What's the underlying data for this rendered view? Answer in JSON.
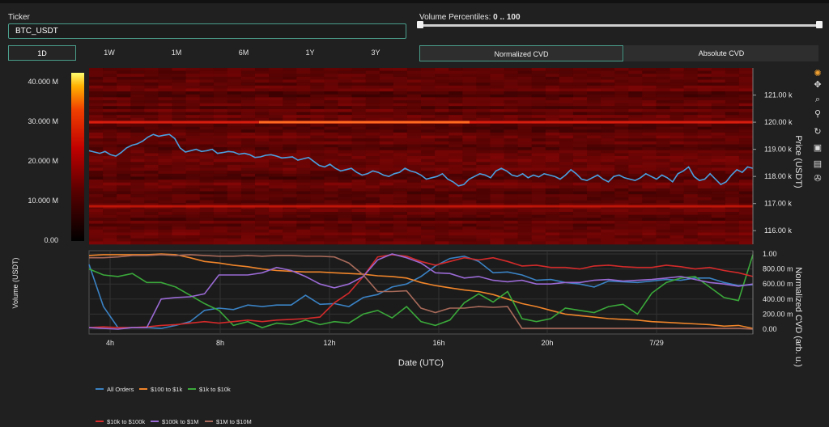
{
  "ticker": {
    "label": "Ticker",
    "value": "BTC_USDT"
  },
  "volume_percentiles": {
    "label": "Volume Percentiles:",
    "value": "0 .. 100",
    "low": 0,
    "high": 100
  },
  "timeframes": [
    {
      "label": "1D",
      "active": true
    },
    {
      "label": "1W",
      "active": false
    },
    {
      "label": "1M",
      "active": false
    },
    {
      "label": "6M",
      "active": false
    },
    {
      "label": "1Y",
      "active": false
    },
    {
      "label": "3Y",
      "active": false
    }
  ],
  "modes": [
    {
      "label": "Normalized CVD",
      "active": true
    },
    {
      "label": "Absolute CVD",
      "active": false
    }
  ],
  "toolbar": {
    "icons": [
      "logo-icon",
      "pan-icon",
      "zoom-icon",
      "lasso-icon",
      "reset-icon",
      "download-icon",
      "comment-icon",
      "settings-icon"
    ]
  },
  "chart_data": [
    {
      "type": "heatmap",
      "title": "",
      "colorbar": {
        "label": "Volume (USDT)",
        "ticks": [
          "40.000 M",
          "30.000 M",
          "20.000 M",
          "10.000 M",
          "0.00"
        ],
        "range": [
          0,
          42000000
        ]
      },
      "ylabel": "Price (USDT)",
      "y_ticks": [
        "121.00 k",
        "120.00 k",
        "119.00 k",
        "118.00 k",
        "117.00 k",
        "116.00 k"
      ],
      "ylim": [
        115500,
        122000
      ],
      "hot_levels": [
        {
          "price": 120000,
          "intensity": 0.75
        },
        {
          "price": 116900,
          "intensity": 0.55
        }
      ],
      "series": [
        {
          "name": "",
          "color": "#4aa0e0",
          "values": [
            118.95,
            118.9,
            118.85,
            118.92,
            118.8,
            118.75,
            118.88,
            119.05,
            119.15,
            119.2,
            119.3,
            119.45,
            119.55,
            119.48,
            119.52,
            119.55,
            119.4,
            119.05,
            118.9,
            118.95,
            119.0,
            118.92,
            118.95,
            119.0,
            118.85,
            118.88,
            118.92,
            118.9,
            118.82,
            118.85,
            118.8,
            118.7,
            118.72,
            118.78,
            118.8,
            118.75,
            118.68,
            118.7,
            118.72,
            118.6,
            118.65,
            118.7,
            118.55,
            118.4,
            118.35,
            118.45,
            118.3,
            118.2,
            118.25,
            118.3,
            118.15,
            118.05,
            118.1,
            118.2,
            118.15,
            118.05,
            118.0,
            118.1,
            118.15,
            118.3,
            118.2,
            118.15,
            118.05,
            117.9,
            117.95,
            118.0,
            118.1,
            117.9,
            117.8,
            117.65,
            117.7,
            117.9,
            118.0,
            118.1,
            118.05,
            117.95,
            118.2,
            118.3,
            118.2,
            118.05,
            118.0,
            118.1,
            117.95,
            118.05,
            117.98,
            118.1,
            118.05,
            118.0,
            117.9,
            118.05,
            118.25,
            118.1,
            117.9,
            117.85,
            117.95,
            118.05,
            117.9,
            117.8,
            118.0,
            118.05,
            117.95,
            117.9,
            117.85,
            117.95,
            118.1,
            118.0,
            117.9,
            118.05,
            117.95,
            117.8,
            118.1,
            118.2,
            118.35,
            118.0,
            117.85,
            117.9,
            118.1,
            117.9,
            117.7,
            117.8,
            118.05,
            118.25,
            118.15,
            118.35,
            118.3
          ]
        }
      ]
    },
    {
      "type": "line",
      "xlabel": "Date (UTC)",
      "ylabel": "Normalized CVD (arb. u.)",
      "x_ticks": [
        "4h",
        "8h",
        "12h",
        "16h",
        "20h",
        "7/29"
      ],
      "y_ticks": [
        "1.00",
        "800.00 m",
        "600.00 m",
        "400.00 m",
        "200.00 m",
        "0.00"
      ],
      "ylim": [
        0,
        1
      ],
      "series": [
        {
          "name": "All Orders",
          "color": "#3a82c4",
          "values": [
            0.86,
            0.3,
            0.02,
            0.02,
            0.02,
            0.01,
            0.05,
            0.1,
            0.25,
            0.28,
            0.26,
            0.32,
            0.3,
            0.32,
            0.32,
            0.45,
            0.33,
            0.34,
            0.3,
            0.42,
            0.46,
            0.56,
            0.6,
            0.7,
            0.84,
            0.94,
            0.97,
            0.9,
            0.75,
            0.76,
            0.72,
            0.65,
            0.66,
            0.62,
            0.6,
            0.56,
            0.64,
            0.63,
            0.62,
            0.64,
            0.66,
            0.65,
            0.68,
            0.68,
            0.62,
            0.58,
            0.59
          ]
        },
        {
          "name": "$100 to $1k",
          "color": "#f0852a",
          "values": [
            0.98,
            0.99,
            0.99,
            0.99,
            0.99,
            1.0,
            0.99,
            0.95,
            0.9,
            0.88,
            0.85,
            0.83,
            0.8,
            0.78,
            0.77,
            0.76,
            0.76,
            0.75,
            0.74,
            0.73,
            0.71,
            0.7,
            0.68,
            0.62,
            0.58,
            0.55,
            0.52,
            0.5,
            0.46,
            0.4,
            0.34,
            0.3,
            0.25,
            0.2,
            0.18,
            0.16,
            0.14,
            0.13,
            0.12,
            0.1,
            0.09,
            0.08,
            0.07,
            0.06,
            0.04,
            0.05,
            0.01
          ]
        },
        {
          "name": "$1k to $10k",
          "color": "#3aa83a",
          "values": [
            0.8,
            0.72,
            0.7,
            0.74,
            0.62,
            0.62,
            0.56,
            0.45,
            0.34,
            0.25,
            0.05,
            0.1,
            0.02,
            0.08,
            0.06,
            0.12,
            0.06,
            0.1,
            0.08,
            0.2,
            0.25,
            0.15,
            0.3,
            0.1,
            0.05,
            0.12,
            0.35,
            0.47,
            0.36,
            0.5,
            0.14,
            0.1,
            0.14,
            0.28,
            0.25,
            0.22,
            0.3,
            0.33,
            0.2,
            0.48,
            0.62,
            0.68,
            0.7,
            0.56,
            0.42,
            0.38,
            0.99
          ]
        },
        {
          "name": "$10k to $100k",
          "color": "#d42a2a",
          "values": [
            0.02,
            0.03,
            0.02,
            0.02,
            0.03,
            0.05,
            0.06,
            0.08,
            0.1,
            0.08,
            0.1,
            0.12,
            0.1,
            0.12,
            0.13,
            0.14,
            0.16,
            0.35,
            0.48,
            0.7,
            0.96,
            0.99,
            0.97,
            0.9,
            0.85,
            0.9,
            0.95,
            0.92,
            0.95,
            0.9,
            0.84,
            0.85,
            0.82,
            0.82,
            0.8,
            0.84,
            0.85,
            0.83,
            0.82,
            0.82,
            0.85,
            0.83,
            0.8,
            0.82,
            0.78,
            0.75,
            0.7
          ]
        },
        {
          "name": "$100k to $1M",
          "color": "#9a6ad4",
          "values": [
            0.02,
            0.01,
            0.0,
            0.02,
            0.02,
            0.4,
            0.42,
            0.43,
            0.47,
            0.72,
            0.72,
            0.72,
            0.75,
            0.82,
            0.78,
            0.7,
            0.6,
            0.55,
            0.6,
            0.7,
            0.92,
            1.0,
            0.95,
            0.88,
            0.75,
            0.74,
            0.68,
            0.7,
            0.65,
            0.63,
            0.65,
            0.6,
            0.6,
            0.62,
            0.62,
            0.65,
            0.66,
            0.64,
            0.65,
            0.66,
            0.68,
            0.7,
            0.66,
            0.62,
            0.6,
            0.57,
            0.6
          ]
        },
        {
          "name": "$1M to $10M",
          "color": "#a86a5a",
          "values": [
            0.95,
            0.95,
            0.96,
            0.98,
            0.98,
            0.99,
            0.98,
            0.99,
            0.98,
            0.97,
            0.97,
            0.98,
            0.97,
            0.98,
            0.98,
            0.97,
            0.97,
            0.96,
            0.88,
            0.72,
            0.5,
            0.5,
            0.51,
            0.28,
            0.22,
            0.28,
            0.28,
            0.3,
            0.29,
            0.3,
            0.01,
            0.01,
            0.01,
            0.01,
            0.01,
            0.01,
            0.01,
            0.01,
            0.01,
            0.01,
            0.01,
            0.01,
            0.01,
            0.01,
            0.01,
            0.01,
            0.0
          ]
        }
      ]
    }
  ],
  "legend": {
    "row1": [
      "All Orders",
      "$100 to $1k",
      "$1k to $10k"
    ],
    "row2": [
      "$10k to $100k",
      "$100k to $1M",
      "$1M to $10M"
    ]
  }
}
